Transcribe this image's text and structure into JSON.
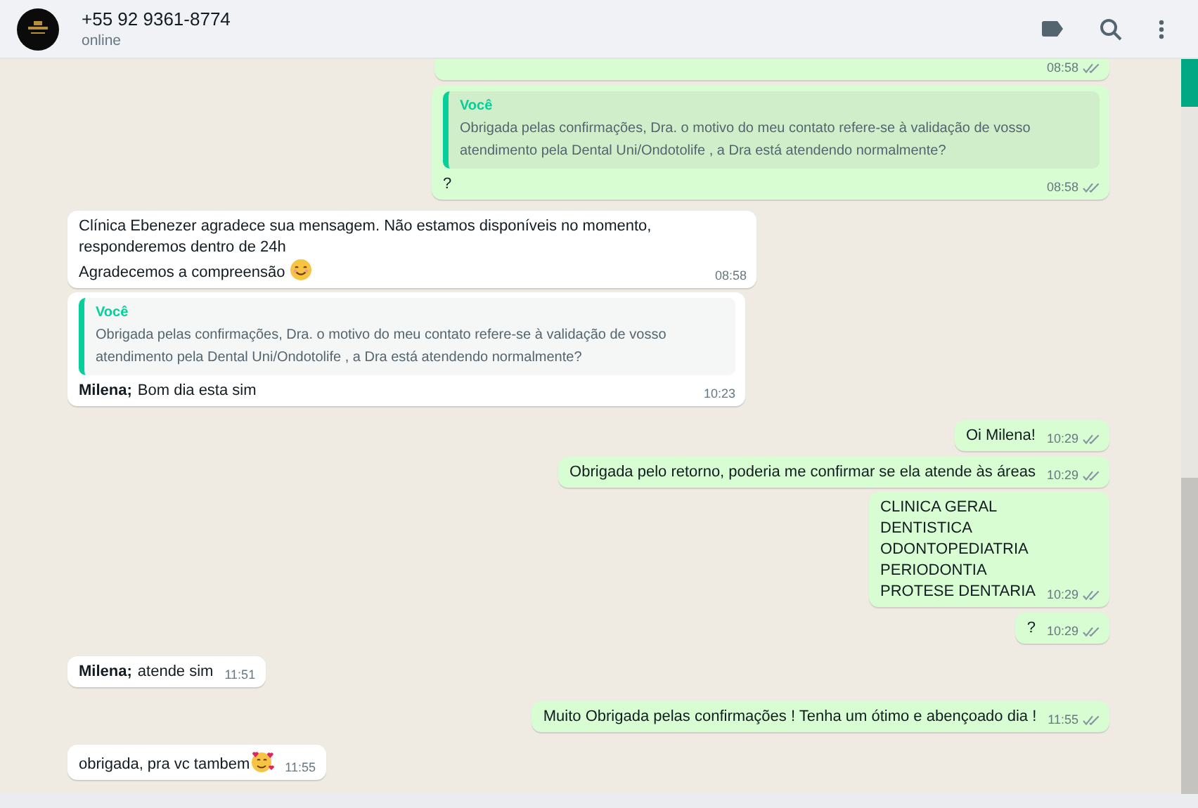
{
  "header": {
    "contact": "+55 92 9361-8774",
    "status": "online"
  },
  "messages": [
    {
      "outgoing": true,
      "time": "08:58",
      "ticks": true
    },
    {
      "outgoing": true,
      "quote": {
        "author": "Você",
        "text": "Obrigada pelas confirmações, Dra. o motivo do meu contato refere-se à validação de vosso atendimento pela Dental Uni/Ondotolife , a Dra está atendendo normalmente?"
      },
      "lines": [
        "?"
      ],
      "time": "08:58",
      "ticks": true
    },
    {
      "outgoing": false,
      "lines": [
        "Clínica Ebenezer agradece sua mensagem. Não estamos disponíveis no momento, responderemos dentro de 24h",
        "Agradecemos a compreensão"
      ],
      "emoji": {
        "kind": "smile"
      },
      "time": "08:58",
      "ticks": false
    },
    {
      "outgoing": false,
      "quote": {
        "author": "Você",
        "text": "Obrigada pelas confirmações, Dra. o motivo do meu contato refere-se à validação de vosso atendimento pela Dental Uni/Ondotolife , a Dra está atendendo normalmente?"
      },
      "sender": "Milena;",
      "lines": [
        "Bom dia esta sim"
      ],
      "time": "10:23",
      "ticks": false
    },
    {
      "outgoing": true,
      "lines": [
        "Oi Milena!"
      ],
      "time": "10:29",
      "ticks": true
    },
    {
      "outgoing": true,
      "lines": [
        "Obrigada pelo retorno, poderia me confirmar se ela atende às áreas"
      ],
      "time": "10:29",
      "ticks": true
    },
    {
      "outgoing": true,
      "lines": [
        "CLINICA GERAL",
        "DENTISTICA",
        "ODONTOPEDIATRIA",
        "PERIODONTIA",
        "PROTESE DENTARIA"
      ],
      "time": "10:29",
      "ticks": true
    },
    {
      "outgoing": true,
      "lines": [
        "?"
      ],
      "time": "10:29",
      "ticks": true
    },
    {
      "outgoing": false,
      "sender": "Milena;",
      "lines": [
        "atende sim"
      ],
      "time": "11:51",
      "ticks": false
    },
    {
      "outgoing": true,
      "lines": [
        "Muito Obrigada pelas confirmações ! Tenha um ótimo e abençoado dia !"
      ],
      "time": "11:55",
      "ticks": true
    },
    {
      "outgoing": false,
      "lines": [
        "obrigada, pra vc tambem"
      ],
      "emoji": {
        "kind": "hearts"
      },
      "time": "11:55",
      "ticks": false
    }
  ]
}
